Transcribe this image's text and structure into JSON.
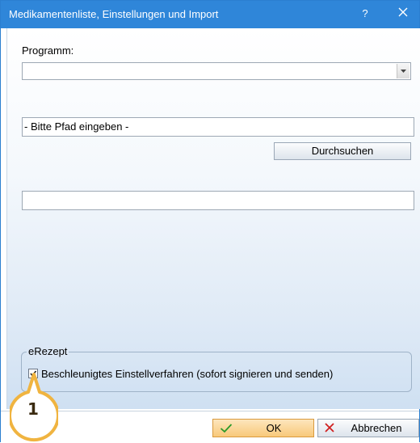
{
  "window": {
    "title": "Medikamentenliste, Einstellungen und Import",
    "help_label": "?",
    "close_icon": "close-icon"
  },
  "form": {
    "program_label": "Programm:",
    "program_value": "",
    "path_value": "- Bitte Pfad eingeben -",
    "browse_label": "Durchsuchen",
    "second_input_value": ""
  },
  "erezept": {
    "group_title": "eRezept",
    "checkbox_checked": true,
    "checkbox_label": "Beschleunigtes Einstellverfahren (sofort signieren und senden)"
  },
  "buttons": {
    "ok_label": "OK",
    "cancel_label": "Abbrechen"
  },
  "annotation": {
    "number": "1"
  },
  "colors": {
    "titlebar": "#2f86d9",
    "ok_button": "#f8c97a",
    "ok_check": "#2a9a2a",
    "cancel_x": "#d02020",
    "marker_border": "#f0b440"
  }
}
